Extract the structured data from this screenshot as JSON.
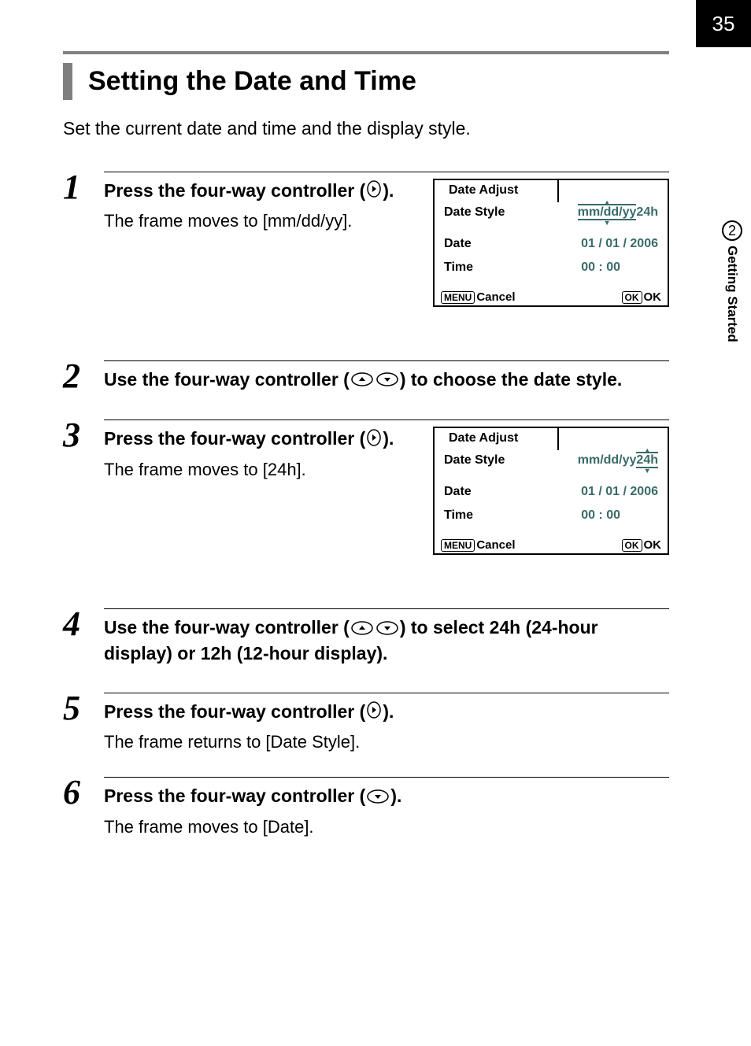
{
  "page_number": "35",
  "chapter": {
    "number": "2",
    "label": "Getting Started"
  },
  "title": "Setting the Date and Time",
  "intro": "Set the current date and time and the display style.",
  "steps": [
    {
      "num": "1",
      "heading_before": "Press the four-way controller (",
      "heading_after": ").",
      "desc": "The frame moves to [mm/dd/yy].",
      "has_lcd": true,
      "highlight": "format"
    },
    {
      "num": "2",
      "heading_before": "Use the four-way controller (",
      "heading_after": ") to choose the date style.",
      "desc": "",
      "has_lcd": false
    },
    {
      "num": "3",
      "heading_before": "Press the four-way controller (",
      "heading_after": ").",
      "desc": "The frame moves to [24h].",
      "has_lcd": true,
      "highlight": "hours"
    },
    {
      "num": "4",
      "heading_before": "Use the four-way controller (",
      "heading_after": ") to select 24h (24-hour display) or 12h (12-hour display).",
      "desc": "",
      "has_lcd": false
    },
    {
      "num": "5",
      "heading_before": "Press the four-way controller (",
      "heading_after": ").",
      "desc": "The frame returns to [Date Style].",
      "has_lcd": false
    },
    {
      "num": "6",
      "heading_before": "Press the four-way controller (",
      "heading_after": ").",
      "desc": "The frame moves to [Date].",
      "has_lcd": false
    }
  ],
  "lcd": {
    "title": "Date Adjust",
    "labels": {
      "style": "Date Style",
      "date": "Date",
      "time": "Time"
    },
    "values": {
      "format": "mm/dd/yy",
      "hours": "24h",
      "date": "01 / 01 / 2006",
      "time": "00 : 00"
    },
    "buttons": {
      "menu": "MENU",
      "cancel": "Cancel",
      "ok_box": "OK",
      "ok": "OK"
    }
  }
}
